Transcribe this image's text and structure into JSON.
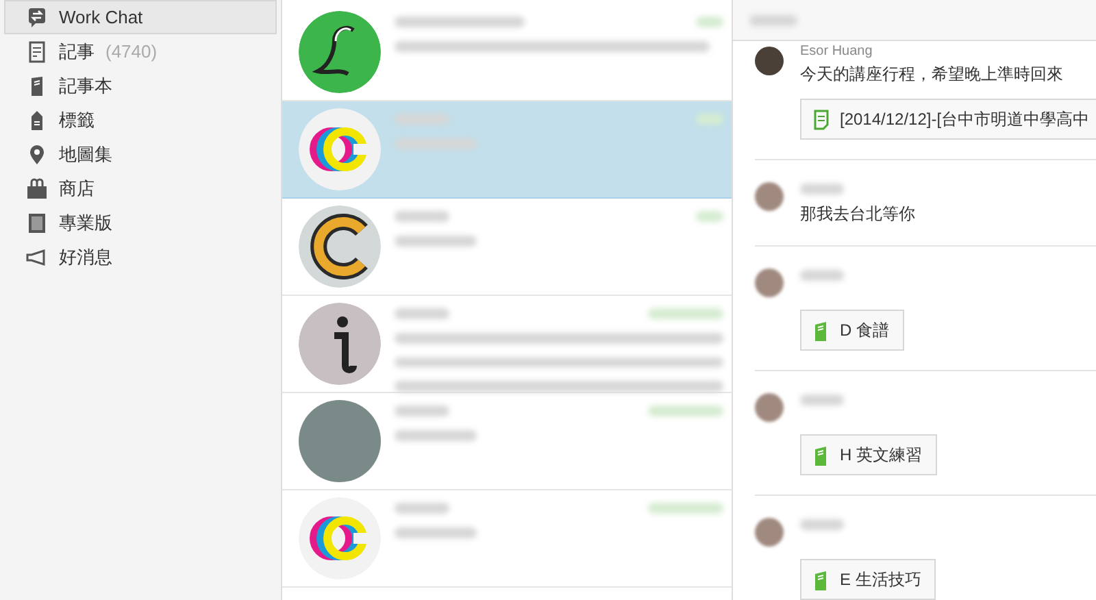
{
  "sidebar": {
    "items": [
      {
        "kind": "chat",
        "label": "Work Chat",
        "selected": true
      },
      {
        "kind": "note",
        "label": "記事",
        "count": "(4740)",
        "selected": false
      },
      {
        "kind": "notebook",
        "label": "記事本",
        "selected": false
      },
      {
        "kind": "tag",
        "label": "標籤",
        "selected": false
      },
      {
        "kind": "atlas",
        "label": "地圖集",
        "selected": false
      },
      {
        "kind": "market",
        "label": "商店",
        "selected": false
      },
      {
        "kind": "premium",
        "label": "專業版",
        "selected": false
      },
      {
        "kind": "news",
        "label": "好消息",
        "selected": false
      }
    ]
  },
  "conversations": [
    {
      "kind": "letter-l",
      "selected": false
    },
    {
      "kind": "cmy-c",
      "selected": true
    },
    {
      "kind": "gold-c",
      "selected": false
    },
    {
      "kind": "letter-i",
      "selected": false
    },
    {
      "kind": "photo",
      "selected": false
    },
    {
      "kind": "cmy-c",
      "selected": false
    }
  ],
  "messages": [
    {
      "author": "Esor Huang",
      "text": "今天的講座行程，希望晚上準時回來",
      "attachment": {
        "kind": "note",
        "title": "[2014/12/12]-[台中市明道中學高中"
      }
    },
    {
      "text": "那我去台北等你"
    },
    {
      "attachment": {
        "kind": "notebook",
        "title": "D 食譜"
      }
    },
    {
      "attachment": {
        "kind": "notebook",
        "title": "H 英文練習"
      }
    },
    {
      "attachment": {
        "kind": "notebook",
        "title": "E 生活技巧"
      }
    }
  ]
}
